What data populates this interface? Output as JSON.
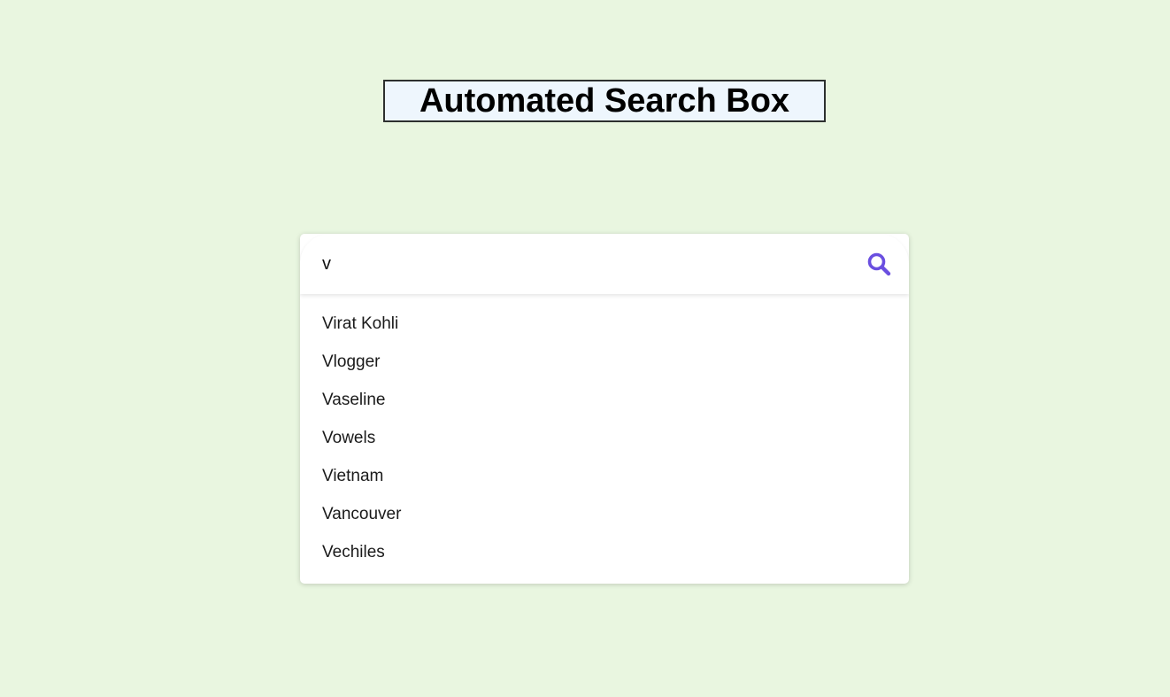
{
  "header": {
    "title": "Automated Search Box"
  },
  "search": {
    "value": "v",
    "icon": "search-icon",
    "accent_color": "#6a4fe0"
  },
  "suggestions": [
    "Virat Kohli",
    "Vlogger",
    "Vaseline",
    "Vowels",
    "Vietnam",
    "Vancouver",
    "Vechiles"
  ]
}
